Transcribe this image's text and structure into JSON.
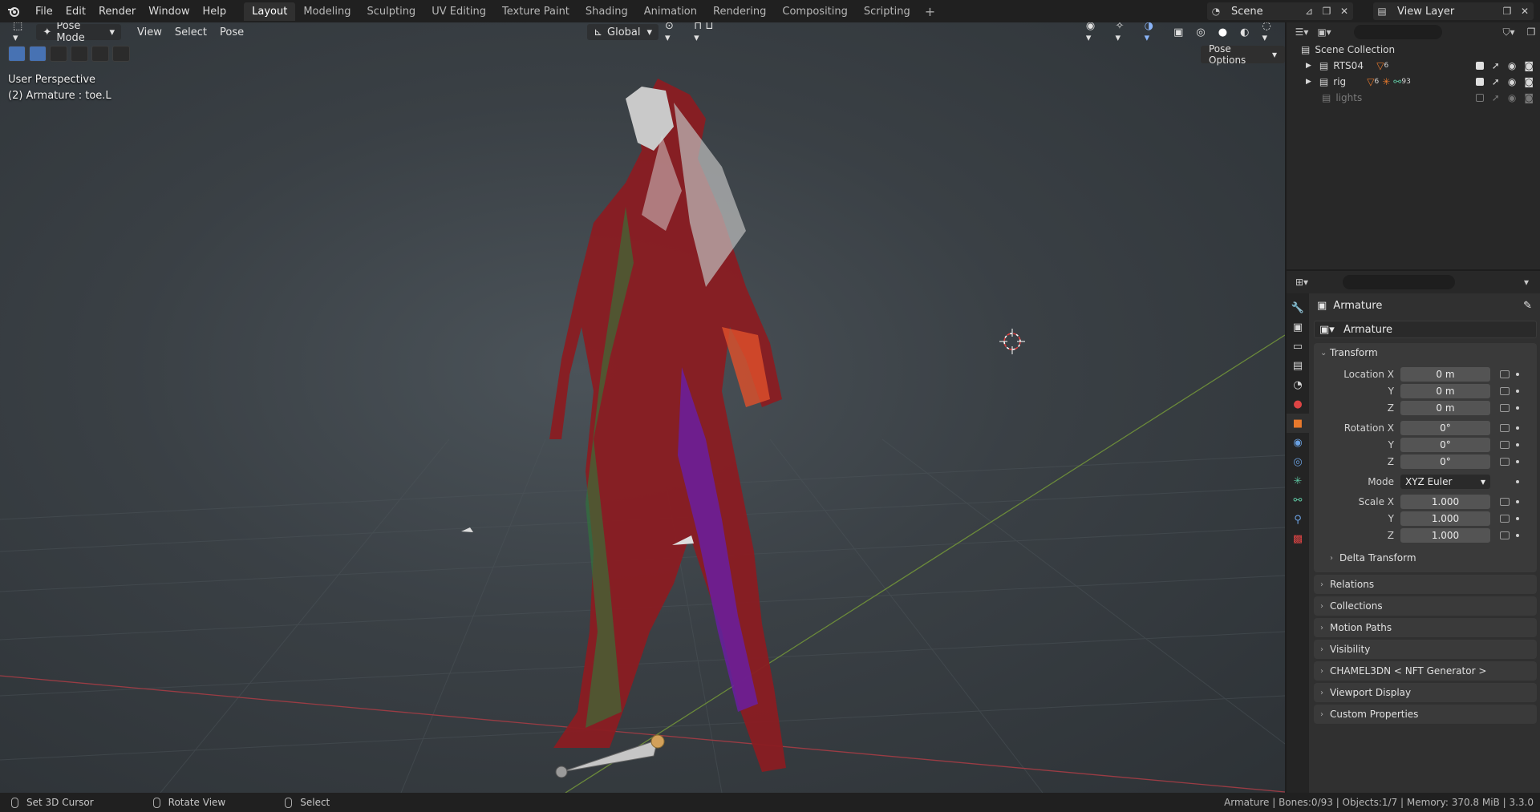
{
  "topbar": {
    "menus": [
      "File",
      "Edit",
      "Render",
      "Window",
      "Help"
    ],
    "workspaces": [
      "Layout",
      "Modeling",
      "Sculpting",
      "UV Editing",
      "Texture Paint",
      "Shading",
      "Animation",
      "Rendering",
      "Compositing",
      "Scripting"
    ],
    "active_workspace": "Layout",
    "scene": "Scene",
    "view_layer": "View Layer"
  },
  "viewport": {
    "mode": "Pose Mode",
    "menus": [
      "View",
      "Select",
      "Pose"
    ],
    "orientation": "Global",
    "perspective": "User Perspective",
    "active": "(2) Armature : toe.L",
    "pose_options": "Pose Options"
  },
  "outliner": {
    "root": "Scene Collection",
    "items": [
      {
        "name": "RTS04",
        "badge": "6",
        "enabled": true
      },
      {
        "name": "rig",
        "badge": "6",
        "badge2": "93",
        "enabled": true
      },
      {
        "name": "lights",
        "badge": "",
        "enabled": false
      }
    ]
  },
  "properties": {
    "object_name": "Armature",
    "data_name": "Armature",
    "transform_label": "Transform",
    "location": {
      "label": "Location X",
      "x": "0 m",
      "y": "0 m",
      "z": "0 m"
    },
    "rotation": {
      "label": "Rotation X",
      "x": "0°",
      "y": "0°",
      "z": "0°"
    },
    "mode": {
      "label": "Mode",
      "value": "XYZ Euler"
    },
    "scale": {
      "label": "Scale X",
      "x": "1.000",
      "y": "1.000",
      "z": "1.000"
    },
    "axis_y": "Y",
    "axis_z": "Z",
    "delta": "Delta Transform",
    "panels": [
      "Relations",
      "Collections",
      "Motion Paths",
      "Visibility",
      "CHAMEL3DN < NFT Generator >",
      "Viewport Display",
      "Custom Properties"
    ]
  },
  "statusbar": {
    "left": [
      "Set 3D Cursor",
      "Rotate View",
      "Select"
    ],
    "right": "Armature | Bones:0/93 | Objects:1/7 | Memory: 370.8 MiB | 3.3.0"
  },
  "colors": {
    "accent": "#4772b3",
    "object_orange": "#e8792c"
  }
}
